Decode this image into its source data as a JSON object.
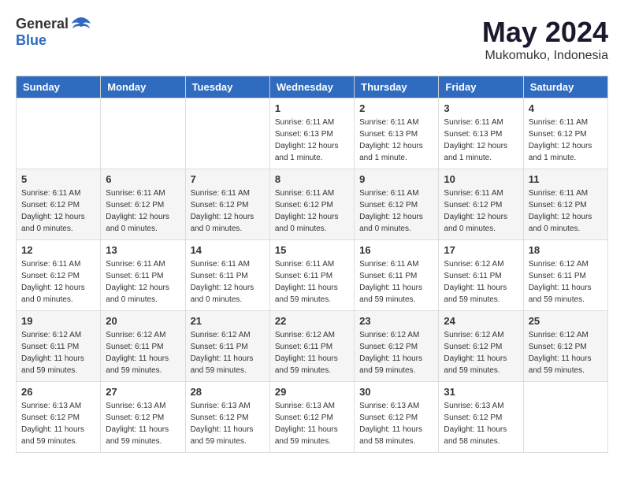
{
  "logo": {
    "text_general": "General",
    "text_blue": "Blue"
  },
  "title": "May 2024",
  "subtitle": "Mukomuko, Indonesia",
  "headers": [
    "Sunday",
    "Monday",
    "Tuesday",
    "Wednesday",
    "Thursday",
    "Friday",
    "Saturday"
  ],
  "weeks": [
    [
      {
        "day": "",
        "info": ""
      },
      {
        "day": "",
        "info": ""
      },
      {
        "day": "",
        "info": ""
      },
      {
        "day": "1",
        "info": "Sunrise: 6:11 AM\nSunset: 6:13 PM\nDaylight: 12 hours\nand 1 minute."
      },
      {
        "day": "2",
        "info": "Sunrise: 6:11 AM\nSunset: 6:13 PM\nDaylight: 12 hours\nand 1 minute."
      },
      {
        "day": "3",
        "info": "Sunrise: 6:11 AM\nSunset: 6:13 PM\nDaylight: 12 hours\nand 1 minute."
      },
      {
        "day": "4",
        "info": "Sunrise: 6:11 AM\nSunset: 6:12 PM\nDaylight: 12 hours\nand 1 minute."
      }
    ],
    [
      {
        "day": "5",
        "info": "Sunrise: 6:11 AM\nSunset: 6:12 PM\nDaylight: 12 hours\nand 0 minutes."
      },
      {
        "day": "6",
        "info": "Sunrise: 6:11 AM\nSunset: 6:12 PM\nDaylight: 12 hours\nand 0 minutes."
      },
      {
        "day": "7",
        "info": "Sunrise: 6:11 AM\nSunset: 6:12 PM\nDaylight: 12 hours\nand 0 minutes."
      },
      {
        "day": "8",
        "info": "Sunrise: 6:11 AM\nSunset: 6:12 PM\nDaylight: 12 hours\nand 0 minutes."
      },
      {
        "day": "9",
        "info": "Sunrise: 6:11 AM\nSunset: 6:12 PM\nDaylight: 12 hours\nand 0 minutes."
      },
      {
        "day": "10",
        "info": "Sunrise: 6:11 AM\nSunset: 6:12 PM\nDaylight: 12 hours\nand 0 minutes."
      },
      {
        "day": "11",
        "info": "Sunrise: 6:11 AM\nSunset: 6:12 PM\nDaylight: 12 hours\nand 0 minutes."
      }
    ],
    [
      {
        "day": "12",
        "info": "Sunrise: 6:11 AM\nSunset: 6:12 PM\nDaylight: 12 hours\nand 0 minutes."
      },
      {
        "day": "13",
        "info": "Sunrise: 6:11 AM\nSunset: 6:11 PM\nDaylight: 12 hours\nand 0 minutes."
      },
      {
        "day": "14",
        "info": "Sunrise: 6:11 AM\nSunset: 6:11 PM\nDaylight: 12 hours\nand 0 minutes."
      },
      {
        "day": "15",
        "info": "Sunrise: 6:11 AM\nSunset: 6:11 PM\nDaylight: 11 hours\nand 59 minutes."
      },
      {
        "day": "16",
        "info": "Sunrise: 6:11 AM\nSunset: 6:11 PM\nDaylight: 11 hours\nand 59 minutes."
      },
      {
        "day": "17",
        "info": "Sunrise: 6:12 AM\nSunset: 6:11 PM\nDaylight: 11 hours\nand 59 minutes."
      },
      {
        "day": "18",
        "info": "Sunrise: 6:12 AM\nSunset: 6:11 PM\nDaylight: 11 hours\nand 59 minutes."
      }
    ],
    [
      {
        "day": "19",
        "info": "Sunrise: 6:12 AM\nSunset: 6:11 PM\nDaylight: 11 hours\nand 59 minutes."
      },
      {
        "day": "20",
        "info": "Sunrise: 6:12 AM\nSunset: 6:11 PM\nDaylight: 11 hours\nand 59 minutes."
      },
      {
        "day": "21",
        "info": "Sunrise: 6:12 AM\nSunset: 6:11 PM\nDaylight: 11 hours\nand 59 minutes."
      },
      {
        "day": "22",
        "info": "Sunrise: 6:12 AM\nSunset: 6:11 PM\nDaylight: 11 hours\nand 59 minutes."
      },
      {
        "day": "23",
        "info": "Sunrise: 6:12 AM\nSunset: 6:12 PM\nDaylight: 11 hours\nand 59 minutes."
      },
      {
        "day": "24",
        "info": "Sunrise: 6:12 AM\nSunset: 6:12 PM\nDaylight: 11 hours\nand 59 minutes."
      },
      {
        "day": "25",
        "info": "Sunrise: 6:12 AM\nSunset: 6:12 PM\nDaylight: 11 hours\nand 59 minutes."
      }
    ],
    [
      {
        "day": "26",
        "info": "Sunrise: 6:13 AM\nSunset: 6:12 PM\nDaylight: 11 hours\nand 59 minutes."
      },
      {
        "day": "27",
        "info": "Sunrise: 6:13 AM\nSunset: 6:12 PM\nDaylight: 11 hours\nand 59 minutes."
      },
      {
        "day": "28",
        "info": "Sunrise: 6:13 AM\nSunset: 6:12 PM\nDaylight: 11 hours\nand 59 minutes."
      },
      {
        "day": "29",
        "info": "Sunrise: 6:13 AM\nSunset: 6:12 PM\nDaylight: 11 hours\nand 59 minutes."
      },
      {
        "day": "30",
        "info": "Sunrise: 6:13 AM\nSunset: 6:12 PM\nDaylight: 11 hours\nand 58 minutes."
      },
      {
        "day": "31",
        "info": "Sunrise: 6:13 AM\nSunset: 6:12 PM\nDaylight: 11 hours\nand 58 minutes."
      },
      {
        "day": "",
        "info": ""
      }
    ]
  ]
}
